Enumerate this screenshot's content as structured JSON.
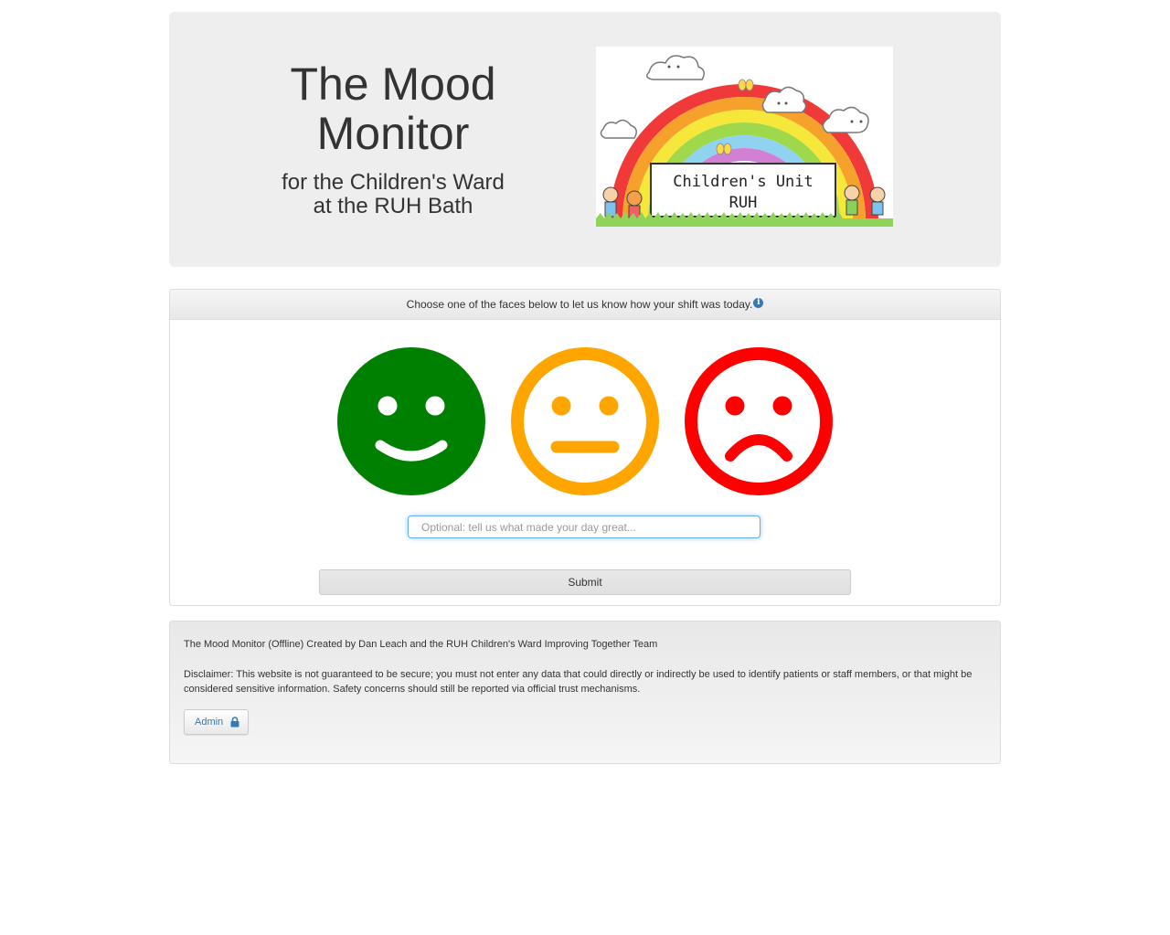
{
  "header": {
    "title_line1": "The Mood",
    "title_line2": "Monitor",
    "subtitle_line1": "for the Children's Ward",
    "subtitle_line2": "at the RUH Bath",
    "logo": {
      "banner_line1": "Children's Unit",
      "banner_line2": "RUH"
    }
  },
  "survey": {
    "prompt": "Choose one of the faces below to let us know how your shift was today.",
    "info_icon": "info-circle-icon",
    "faces": [
      {
        "mood": "happy",
        "color": "#008000"
      },
      {
        "mood": "neutral",
        "color": "#ffa500"
      },
      {
        "mood": "sad",
        "color": "#ff0000"
      }
    ],
    "comment_placeholder": "Optional: tell us what made your day great...",
    "comment_value": "",
    "submit_label": "Submit"
  },
  "footer": {
    "credit": "The Mood Monitor (Offline) Created by Dan Leach and the RUH Children's Ward Improving Together Team",
    "disclaimer": "Disclaimer: This website is not guaranteed to be secure; you must not enter any data that could directly or indirectly be used to identify patients or staff members, or that might be considered sensitive information. Safety concerns should still be reported via official trust mechanisms.",
    "admin_label": "Admin",
    "admin_icon": "lock-icon",
    "link_color": "#337ab7"
  }
}
